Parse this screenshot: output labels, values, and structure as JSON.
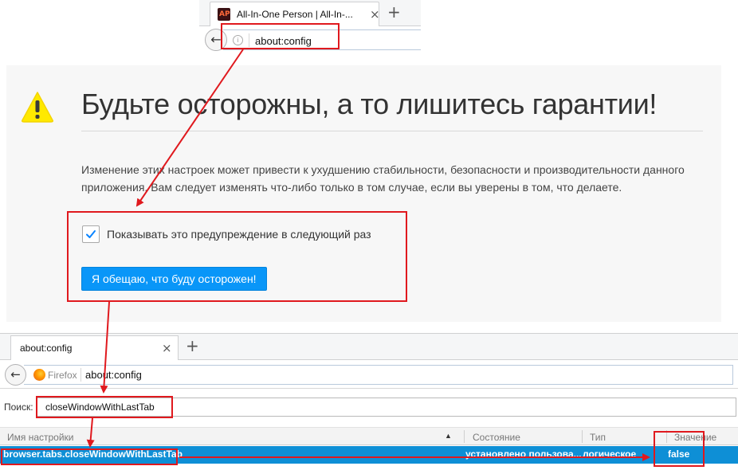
{
  "top_browser": {
    "tab_title": "All-In-One Person | All-In-...",
    "favicon_text": "AP",
    "close_glyph": "×",
    "new_tab_glyph": "+",
    "back_glyph": "←",
    "info_glyph": "i",
    "url": "about:config"
  },
  "warning": {
    "title": "Будьте осторожны, а то лишитесь гарантии!",
    "body": "Изменение этих настроек может привести к ухудшению стабильности, безопасности и производительности данного приложения. Вам следует изменять что-либо только в том случае, если вы уверены в том, что делаете.",
    "checkbox_label": "Показывать это предупреждение в следующий раз",
    "checkbox_checked": true,
    "accept_button": "Я обещаю, что буду осторожен!",
    "icon": "warning-triangle-icon",
    "icon_color": "#ffe900"
  },
  "bottom_browser": {
    "tab_title": "about:config",
    "close_glyph": "×",
    "new_tab_glyph": "+",
    "back_glyph": "←",
    "identity_label": "Firefox",
    "url": "about:config",
    "search_label": "Поиск:",
    "search_value": "closeWindowWithLastTab",
    "columns": {
      "name": "Имя настройки",
      "status": "Состояние",
      "type": "Тип",
      "value": "Значение"
    },
    "sort_glyph": "▲",
    "row": {
      "name": "browser.tabs.closeWindowWithLastTab",
      "status": "установлено пользова...",
      "type": "логическое",
      "value": "false"
    },
    "selection_color": "#0e8fd6"
  },
  "annotation_color": "#e0191e"
}
